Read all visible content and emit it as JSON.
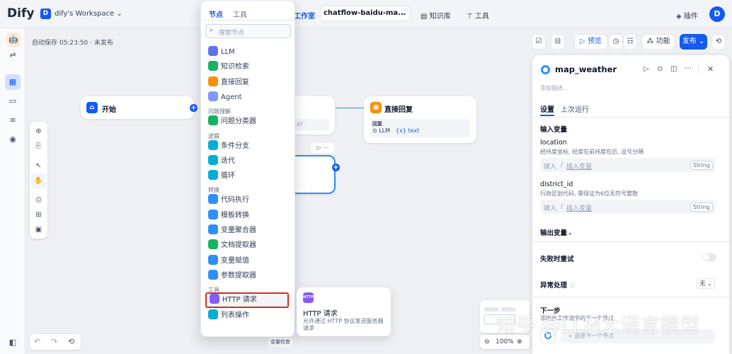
{
  "app": {
    "logo": "Dify",
    "workspace_initial": "D",
    "workspace": "dify's Workspace",
    "studio": "工作室",
    "app_name": "chatflow-baidu-ma...",
    "knowledge": "知识库",
    "tools": "工具",
    "plugins": "插件",
    "avatar": "D"
  },
  "status": {
    "autosave": "自动保存 05:23:50 · 未发布"
  },
  "header_actions": {
    "preview": "预览",
    "features": "功能",
    "publish": "发布"
  },
  "canvas": {
    "start_node": {
      "title": "开始"
    },
    "answer_node": {
      "title": "直接回复",
      "section": "回复",
      "llm": "LLM",
      "var": "{x} text"
    },
    "hidden_tag": "AT",
    "var_check": "变量检查"
  },
  "node_menu": {
    "tabs": [
      "节点",
      "工具"
    ],
    "search_placeholder": "搜索节点",
    "top_items": [
      {
        "label": "LLM",
        "color": "#6172f3"
      },
      {
        "label": "知识检索",
        "color": "#16b364"
      },
      {
        "label": "直接回复",
        "color": "#f79009"
      },
      {
        "label": "Agent",
        "color": "#8098f9"
      }
    ],
    "cat1": "问题理解",
    "cat1_items": [
      {
        "label": "问题分类器",
        "color": "#16b364"
      }
    ],
    "cat2": "逻辑",
    "cat2_items": [
      {
        "label": "条件分支",
        "color": "#06aed4"
      },
      {
        "label": "迭代",
        "color": "#06aed4"
      },
      {
        "label": "循环",
        "color": "#06aed4"
      }
    ],
    "cat3": "转换",
    "cat3_items": [
      {
        "label": "代码执行",
        "color": "#2e90fa"
      },
      {
        "label": "模板转换",
        "color": "#2e90fa"
      },
      {
        "label": "变量聚合器",
        "color": "#2e90fa"
      },
      {
        "label": "文档提取器",
        "color": "#16b364"
      },
      {
        "label": "变量赋值",
        "color": "#2e90fa"
      },
      {
        "label": "参数提取器",
        "color": "#2e90fa"
      }
    ],
    "cat4": "工具",
    "cat4_items": [
      {
        "label": "HTTP 请求",
        "color": "#875bf7",
        "selected": true
      },
      {
        "label": "列表操作",
        "color": "#06aed4"
      }
    ]
  },
  "tooltip": {
    "badge": "HTTP",
    "title": "HTTP 请求",
    "desc": "允许通过 HTTP 协议发送服务器请求"
  },
  "panel": {
    "title": "map_weather",
    "desc_placeholder": "添加描述...",
    "tabs": [
      "设置",
      "上次运行"
    ],
    "input_vars_label": "输入变量",
    "vars": [
      {
        "name": "location",
        "desc": "经纬度坐标, 经度在前纬度在后, 逗号分隔",
        "placeholder_a": "键入",
        "placeholder_b": "插入变量",
        "type": "String"
      },
      {
        "name": "district_id",
        "desc": "行政区划代码, 需保证为6位无符号整数",
        "placeholder_a": "键入",
        "placeholder_b": "插入变量",
        "type": "String"
      }
    ],
    "output_vars": "输出变量",
    "retry": "失败时重试",
    "exception": "异常处理",
    "exception_value": "无",
    "next_step": "下一步",
    "next_desc": "添加此工作流中的下一个节点",
    "next_select": "选择下一个节点"
  },
  "zoom": {
    "level": "100%"
  },
  "watermark": "知乎 @LLM大语言模型"
}
